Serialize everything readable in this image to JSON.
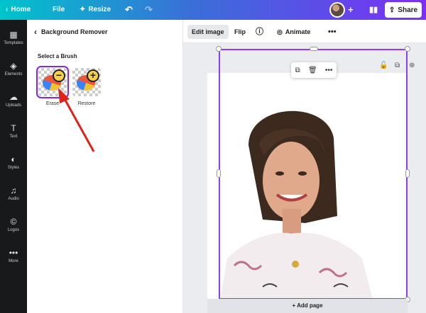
{
  "topbar": {
    "home_label": "Home",
    "file_label": "File",
    "resize_label": "Resize",
    "share_label": "Share",
    "undo_icon": "undo-icon",
    "redo_icon": "redo-icon",
    "plus_icon": "plus-icon",
    "chart_icon": "chart-icon"
  },
  "rail": {
    "items": [
      {
        "label": "Templates",
        "icon": "templates-icon",
        "glyph": "▦"
      },
      {
        "label": "Elements",
        "icon": "elements-icon",
        "glyph": "◈"
      },
      {
        "label": "Uploads",
        "icon": "uploads-icon",
        "glyph": "☁"
      },
      {
        "label": "Text",
        "icon": "text-icon",
        "glyph": "T"
      },
      {
        "label": "Styles",
        "icon": "styles-icon",
        "glyph": "◐"
      },
      {
        "label": "Audio",
        "icon": "audio-icon",
        "glyph": "♫"
      },
      {
        "label": "Logos",
        "icon": "logos-icon",
        "glyph": "©"
      },
      {
        "label": "More",
        "icon": "more-icon",
        "glyph": "•••"
      }
    ]
  },
  "panel": {
    "back_label": "Background Remover",
    "brush_title": "Select a Brush",
    "brushes": [
      {
        "label": "Erase",
        "selected": true
      },
      {
        "label": "Restore",
        "selected": false
      }
    ]
  },
  "image_toolbar": {
    "edit_image_label": "Edit image",
    "flip_label": "Flip",
    "animate_label": "Animate",
    "info_icon": "info-icon",
    "more_icon": "more-icon"
  },
  "canvas": {
    "add_page_label": "+ Add page",
    "selection_color": "#8b3dff"
  },
  "colors": {
    "accent": "#7d2ae8",
    "arrow": "#e0221a"
  }
}
